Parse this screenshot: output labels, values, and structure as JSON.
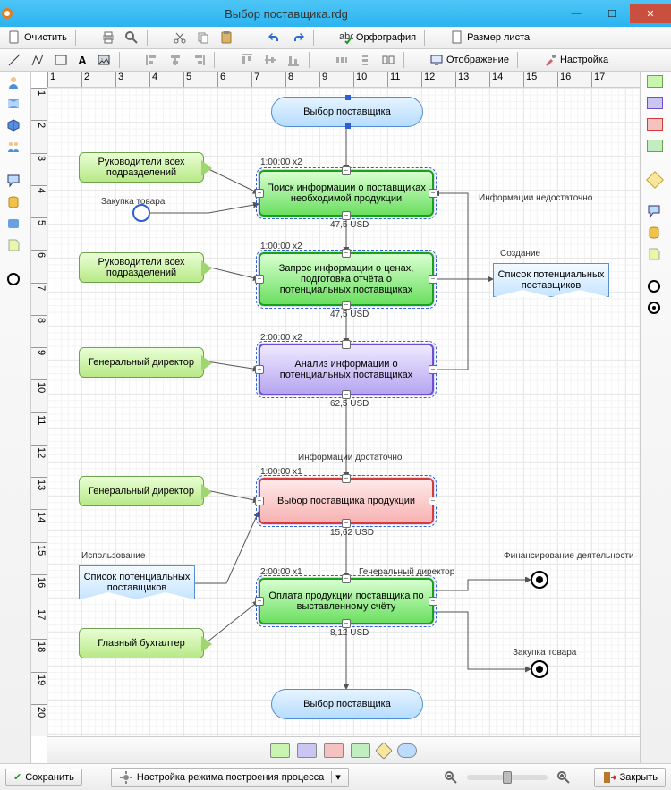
{
  "window": {
    "title": "Выбор поставщика.rdg"
  },
  "toolbar1": {
    "clear": "Очистить",
    "spellcheck": "Орфография",
    "pagesize": "Размер листа"
  },
  "toolbar2": {
    "display": "Отображение",
    "settings": "Настройка"
  },
  "ruler_h": [
    "1",
    "2",
    "3",
    "4",
    "5",
    "6",
    "7",
    "8",
    "9",
    "10",
    "11",
    "12",
    "13",
    "14",
    "15",
    "16",
    "17"
  ],
  "ruler_v": [
    "1",
    "2",
    "3",
    "4",
    "5",
    "6",
    "7",
    "8",
    "9",
    "10",
    "11",
    "12",
    "13",
    "14",
    "15",
    "16",
    "17",
    "18",
    "19",
    "20"
  ],
  "diagram": {
    "start": {
      "label": "Выбор поставщика"
    },
    "end": {
      "label": "Выбор поставщика"
    },
    "roles": {
      "r1": "Руководители всех подразделений",
      "r2": "Руководители всех подразделений",
      "r3": "Генеральный директор",
      "r4": "Генеральный директор",
      "r5": "Главный бухгалтер"
    },
    "docs": {
      "d1": {
        "uselabel": "Использование",
        "text": "Список потенциальных поставщиков"
      },
      "d2": {
        "createlabel": "Создание",
        "text": "Список потенциальных поставщиков"
      }
    },
    "proc": {
      "p1": "Поиск информации о поставщиках необходимой продукции",
      "p2": "Запрос информации о ценах, подготовка отчёта о потенциальных поставщиках",
      "p3": "Анализ информации о потенциальных поставщиках",
      "p4": "Выбор поставщика продукции",
      "p5": "Оплата продукции поставщика по выставленному счёту"
    },
    "times": {
      "p1": "1:00:00 x2",
      "p2": "1:00:00 x2",
      "p3": "2:00:00 x2",
      "p4": "1:00:00 x1",
      "p5": "2:00:00 x1"
    },
    "costs": {
      "p1": "47,5 USD",
      "p2": "47,5 USD",
      "p3": "62,5 USD",
      "p4": "15,62 USD",
      "p5": "8,12 USD"
    },
    "labels": {
      "not_enough": "Информации недостаточно",
      "enough": "Информации достаточно",
      "purchase": "Закупка товара",
      "gendir": "Генеральный директор",
      "financing": "Финансирование деятельности",
      "purchase2": "Закупка товара"
    }
  },
  "colors": {
    "proc_green_fill": "linear-gradient(#d8ffd0,#6adf5f)",
    "proc_green_border": "#18a218",
    "proc_purple_fill": "linear-gradient(#eee9ff,#b6a5f0)",
    "proc_purple_border": "#6e4fd2",
    "proc_red_fill": "linear-gradient(#ffeaea,#f7b2b2)",
    "proc_red_border": "#d43c3c"
  },
  "legend_colors": [
    "#b6f29d",
    "#c9c6f2",
    "#f5c2c2",
    "#c9f0c0",
    "#f7e79a",
    "#bcdcff"
  ],
  "status": {
    "save": "Сохранить",
    "mode": "Настройка режима построения процесса",
    "close": "Закрыть"
  }
}
